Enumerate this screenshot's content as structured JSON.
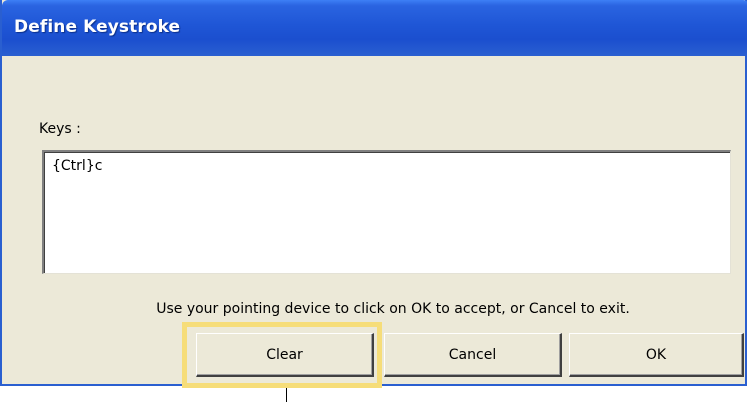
{
  "window": {
    "title": "Define Keystroke"
  },
  "keys": {
    "label": "Keys :",
    "value": "{Ctrl}c"
  },
  "instructions": "Use your pointing device to click on OK to accept, or Cancel to exit.",
  "buttons": {
    "clear": "Clear",
    "cancel": "Cancel",
    "ok": "OK"
  },
  "colors": {
    "titlebar": "#1f56d6",
    "dialog_bg": "#ece9d8",
    "highlight": "#f6dd79"
  }
}
